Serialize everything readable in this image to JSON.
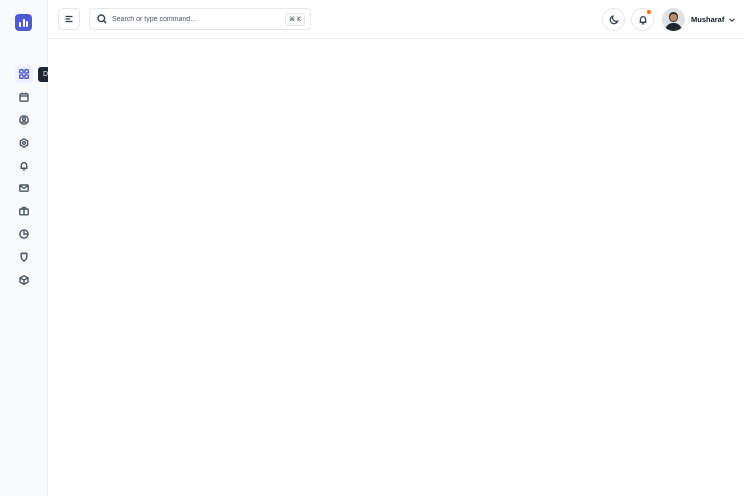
{
  "sidebar": {
    "items": [
      {
        "id": "dashboard",
        "icon": "grid-icon",
        "active": true
      },
      {
        "id": "calendar",
        "icon": "calendar-icon",
        "active": false
      },
      {
        "id": "profile",
        "icon": "user-circle-icon",
        "active": false
      },
      {
        "id": "settings",
        "icon": "gear-icon",
        "active": false
      },
      {
        "id": "notifications",
        "icon": "bell-icon",
        "active": false
      },
      {
        "id": "mail",
        "icon": "mail-icon",
        "active": false
      },
      {
        "id": "briefcase",
        "icon": "briefcase-icon",
        "active": false
      },
      {
        "id": "reports",
        "icon": "pie-chart-icon",
        "active": false
      },
      {
        "id": "security",
        "icon": "shield-icon",
        "active": false
      },
      {
        "id": "packages",
        "icon": "box-icon",
        "active": false
      }
    ],
    "tooltip": "Dashboard"
  },
  "header": {
    "search": {
      "placeholder": "Search or type command..."
    },
    "shortcut": "⌘ K",
    "user": {
      "name": "Musharaf"
    }
  },
  "colors": {
    "accent": "#4f5bd5",
    "notification_dot": "#f97316",
    "tooltip_bg": "#1f2533"
  }
}
